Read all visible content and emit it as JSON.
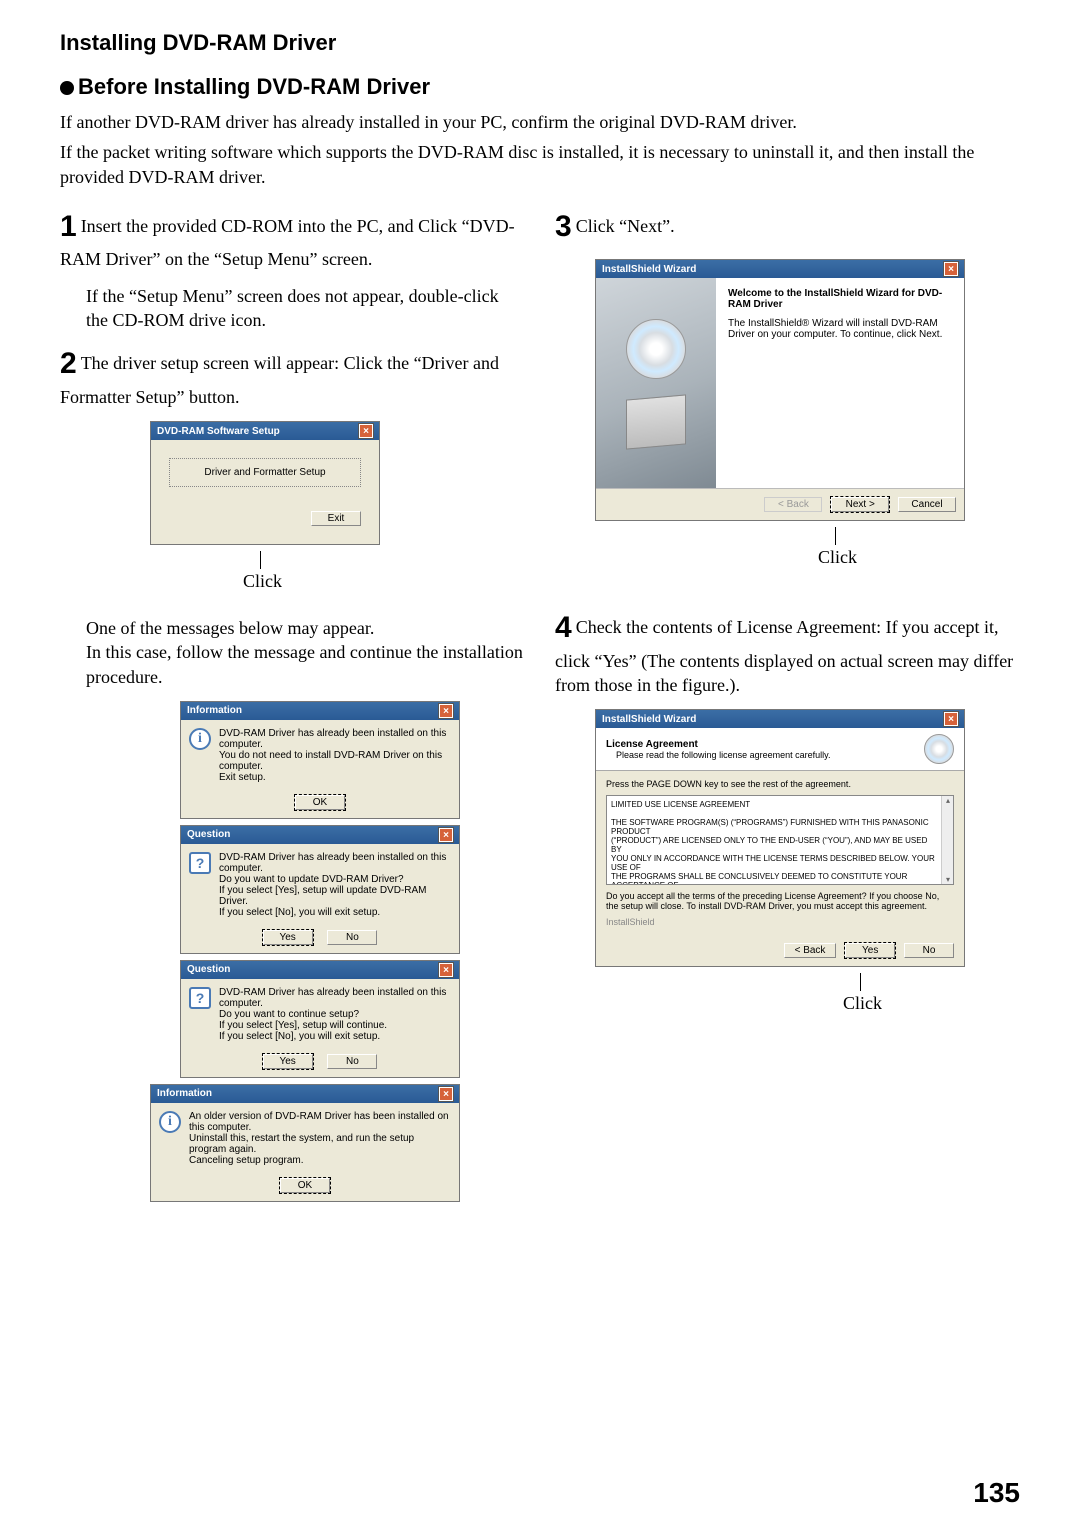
{
  "page": {
    "number": "135",
    "title": "Installing DVD-RAM Driver",
    "sub": "Before Installing DVD-RAM Driver",
    "intro1": "If another DVD-RAM driver has already installed in your PC, confirm the original DVD-RAM driver.",
    "intro2": "If the packet writing software which supports the DVD-RAM disc is installed, it is necessary to uninstall it, and then install the provided DVD-RAM driver."
  },
  "steps": {
    "s1a": "Insert the provided CD-ROM into the PC, and Click “DVD-RAM Driver” on the “Setup Menu” screen.",
    "s1b": "If the “Setup Menu” screen does not appear, double-click the CD-ROM drive icon.",
    "s2": "The driver setup screen will appear: Click the “Driver and Formatter Setup” button.",
    "s2note": "One of the messages below may appear.\nIn this case, follow the message and continue the installation procedure.",
    "s3": "Click “Next”.",
    "s4": "Check the contents of License Agreement: If you accept it, click “Yes” (The contents displayed on actual screen may differ from those in the figure.)."
  },
  "labels": {
    "click": "Click"
  },
  "setup_dlg": {
    "title": "DVD-RAM Software Setup",
    "btn": "Driver and Formatter Setup",
    "exit": "Exit"
  },
  "info1": {
    "title": "Information",
    "text": "DVD-RAM Driver has already been installed on this computer.\nYou do not need to install DVD-RAM Driver on this computer.\nExit setup.",
    "ok": "OK"
  },
  "q1": {
    "title": "Question",
    "text": "DVD-RAM Driver has already been installed on this computer.\nDo you want to update DVD-RAM Driver?\nIf you select [Yes], setup will update DVD-RAM Driver.\nIf you select [No], you will exit setup.",
    "yes": "Yes",
    "no": "No"
  },
  "q2": {
    "title": "Question",
    "text": "DVD-RAM Driver has already been installed on this computer.\nDo you want to continue setup?\nIf you select [Yes], setup will continue.\nIf you select [No], you will exit setup.",
    "yes": "Yes",
    "no": "No"
  },
  "info2": {
    "title": "Information",
    "text": "An older version of DVD-RAM Driver has been installed on this computer.\nUninstall this, restart the system, and run the setup program again.\nCanceling setup program.",
    "ok": "OK"
  },
  "wizard": {
    "title": "InstallShield Wizard",
    "h": "Welcome to the InstallShield Wizard for DVD-RAM Driver",
    "p": "The InstallShield® Wizard will install DVD-RAM Driver on your computer. To continue, click Next.",
    "back": "< Back",
    "next": "Next >",
    "cancel": "Cancel"
  },
  "license": {
    "title": "InstallShield Wizard",
    "h": "License Agreement",
    "sub": "Please read the following license agreement carefully.",
    "hint": "Press the PAGE DOWN key to see the rest of the agreement.",
    "body": "LIMITED USE LICENSE AGREEMENT\n\nTHE SOFTWARE PROGRAM(S) (“PROGRAMS”) FURNISHED WITH THIS PANASONIC PRODUCT\n(“PRODUCT”) ARE LICENSED ONLY TO THE END-USER (“YOU”), AND MAY BE USED BY\nYOU ONLY IN ACCORDANCE WITH THE LICENSE TERMS DESCRIBED BELOW. YOUR USE OF\nTHE PROGRAMS SHALL BE CONCLUSIVELY DEEMED TO CONSTITUTE YOUR ACCEPTANCE OF",
    "q": "Do you accept all the terms of the preceding License Agreement? If you choose No, the setup will close. To install DVD-RAM Driver, you must accept this agreement.",
    "group": "InstallShield",
    "back": "< Back",
    "yes": "Yes",
    "no": "No"
  }
}
